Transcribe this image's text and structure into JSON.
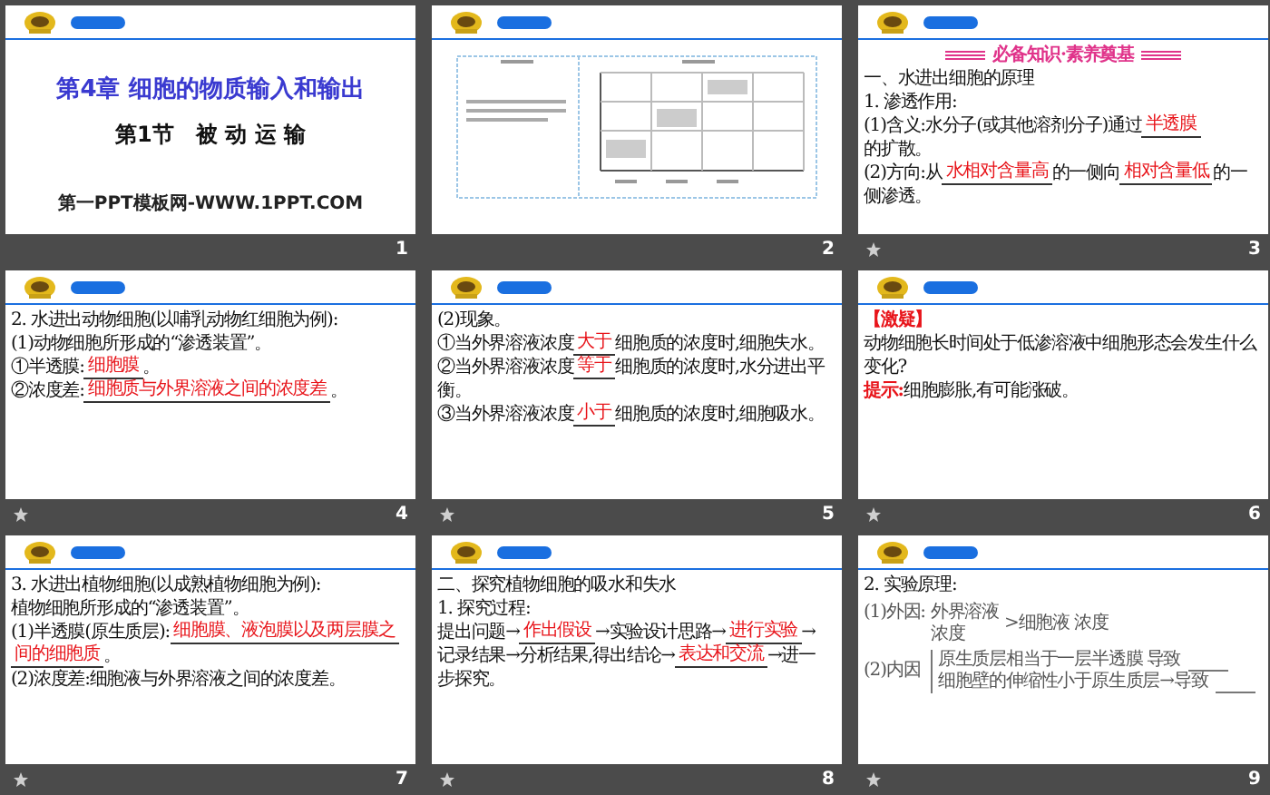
{
  "slides": [
    {
      "number": "1",
      "transition_icon": false,
      "kind": "title",
      "title": "第4章  细胞的物质输入和输出",
      "subtitle": "第1节　被 动 运 输",
      "footer": "第一PPT模板网-WWW.1PPT.COM"
    },
    {
      "number": "2",
      "transition_icon": false,
      "kind": "table"
    },
    {
      "number": "3",
      "transition_icon": true,
      "kind": "lines",
      "banner": "必备知识·素养奠基",
      "lines": [
        [
          {
            "kind": "text",
            "text": "一、水进出细胞的原理"
          }
        ],
        [
          {
            "kind": "text",
            "text": "1. 渗透作用:"
          }
        ],
        [
          {
            "kind": "text",
            "text": "(1)含义:水分子(或其他溶剂分子)通过"
          },
          {
            "kind": "blank",
            "text": "半透膜"
          },
          {
            "kind": "text",
            "text": "的扩散。"
          }
        ],
        [
          {
            "kind": "text",
            "text": "(2)方向:从"
          },
          {
            "kind": "blank",
            "text": "水相对含量高"
          },
          {
            "kind": "text",
            "text": "的一侧向"
          },
          {
            "kind": "blank",
            "text": "相对含量低"
          },
          {
            "kind": "text",
            "text": "的一"
          }
        ],
        [
          {
            "kind": "text",
            "text": "侧渗透。"
          }
        ]
      ]
    },
    {
      "number": "4",
      "transition_icon": true,
      "kind": "lines",
      "lines": [
        [
          {
            "kind": "text",
            "text": "2. 水进出动物细胞(以哺乳动物红细胞为例):"
          }
        ],
        [
          {
            "kind": "text",
            "text": "(1)动物细胞所形成的“渗透装置”。"
          }
        ],
        [
          {
            "kind": "text",
            "text": "①半透膜:"
          },
          {
            "kind": "blank",
            "text": "细胞膜"
          },
          {
            "kind": "text",
            "text": "。"
          }
        ],
        [
          {
            "kind": "text",
            "text": "②浓度差:"
          },
          {
            "kind": "blank",
            "text": "细胞质与外界溶液之间的浓度差"
          },
          {
            "kind": "text",
            "text": "。"
          }
        ]
      ]
    },
    {
      "number": "5",
      "transition_icon": true,
      "kind": "lines",
      "lines": [
        [
          {
            "kind": "text",
            "text": "(2)现象。"
          }
        ],
        [
          {
            "kind": "text",
            "text": "①当外界溶液浓度"
          },
          {
            "kind": "blank",
            "text": "大于"
          },
          {
            "kind": "text",
            "text": "细胞质的浓度时,细胞失水。"
          }
        ],
        [
          {
            "kind": "text",
            "text": "②当外界溶液浓度"
          },
          {
            "kind": "blank",
            "text": "等于"
          },
          {
            "kind": "text",
            "text": "细胞质的浓度时,水分进出平"
          }
        ],
        [
          {
            "kind": "text",
            "text": "衡。"
          }
        ],
        [
          {
            "kind": "text",
            "text": "③当外界溶液浓度"
          },
          {
            "kind": "blank",
            "text": "小于"
          },
          {
            "kind": "text",
            "text": "细胞质的浓度时,细胞吸水。"
          }
        ]
      ]
    },
    {
      "number": "6",
      "transition_icon": true,
      "kind": "lines",
      "lines": [
        [
          {
            "kind": "red",
            "text": "【激疑】"
          }
        ],
        [
          {
            "kind": "text",
            "text": "动物细胞长时间处于低渗溶液中细胞形态会发生什么"
          }
        ],
        [
          {
            "kind": "text",
            "text": "变化?"
          }
        ],
        [
          {
            "kind": "red",
            "text": "提示:"
          },
          {
            "kind": "text",
            "text": "细胞膨胀,有可能涨破。"
          }
        ]
      ]
    },
    {
      "number": "7",
      "transition_icon": true,
      "kind": "lines",
      "lines": [
        [
          {
            "kind": "text",
            "text": "3. 水进出植物细胞(以成熟植物细胞为例):"
          }
        ],
        [
          {
            "kind": "text",
            "text": "植物细胞所形成的“渗透装置”。"
          }
        ],
        [
          {
            "kind": "text",
            "text": "(1)半透膜(原生质层):"
          },
          {
            "kind": "blank",
            "text": "细胞膜、液泡膜以及两层膜之"
          }
        ],
        [
          {
            "kind": "blank",
            "text": "间的细胞质"
          },
          {
            "kind": "text",
            "text": "。"
          }
        ],
        [
          {
            "kind": "text",
            "text": "(2)浓度差:细胞液与外界溶液之间的浓度差。"
          }
        ]
      ]
    },
    {
      "number": "8",
      "transition_icon": true,
      "kind": "lines",
      "lines": [
        [
          {
            "kind": "text",
            "text": "二、探究植物细胞的吸水和失水"
          }
        ],
        [
          {
            "kind": "text",
            "text": "1. 探究过程:"
          }
        ],
        [
          {
            "kind": "text",
            "text": "提出问题→"
          },
          {
            "kind": "blank",
            "text": "作出假设"
          },
          {
            "kind": "text",
            "text": "→实验设计思路→"
          },
          {
            "kind": "blank",
            "text": "进行实验"
          },
          {
            "kind": "text",
            "text": "→"
          }
        ],
        [
          {
            "kind": "text",
            "text": "记录结果→分析结果,得出结论→"
          },
          {
            "kind": "blank",
            "text": "表达和交流"
          },
          {
            "kind": "text",
            "text": "→进一"
          }
        ],
        [
          {
            "kind": "text",
            "text": "步探究。"
          }
        ]
      ]
    },
    {
      "number": "9",
      "transition_icon": true,
      "kind": "lines",
      "lines": [
        [
          {
            "kind": "text",
            "text": "2. 实验原理:"
          }
        ]
      ],
      "diagram": {
        "outer_label": "(1)外因:",
        "outer_top": "外界溶液",
        "outer_bottom": "浓度",
        "outer_compare": ">细胞液 浓度",
        "inner_label": "(2)内因",
        "inner_items": [
          "原生质层相当于一层半透膜",
          "细胞壁的伸缩性小于原生质层→导致"
        ],
        "result": "导致"
      }
    }
  ]
}
